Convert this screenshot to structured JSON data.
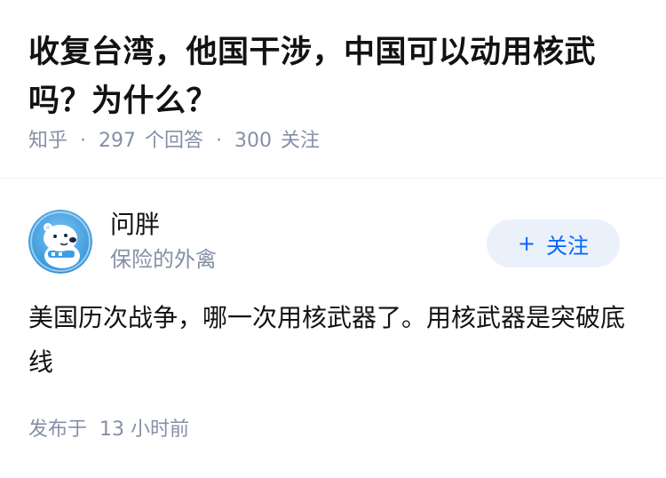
{
  "question": {
    "title": "收复台湾，他国干涉，中国可以动用核武吗？为什么？",
    "source": "知乎",
    "separator": "·",
    "answer_count": "297",
    "answer_label": "个回答",
    "follow_count": "300",
    "follow_label": "关注"
  },
  "answer": {
    "author_name": "问胖",
    "author_bio": "保险的外禽",
    "follow_button": {
      "icon": "plus-icon",
      "icon_glyph": "+",
      "label": "关注"
    },
    "content": "美国历次战争，哪一次用核武器了。用核武器是突破底线",
    "publish_prefix": "发布于",
    "publish_time": "13 小时前"
  },
  "colors": {
    "title": "#121212",
    "meta": "#8590a6",
    "brand_blue": "#0066ff",
    "follow_bg": "#ebf1fb",
    "divider": "#f0f2f7",
    "avatar_bg": "#4aa3e0"
  }
}
